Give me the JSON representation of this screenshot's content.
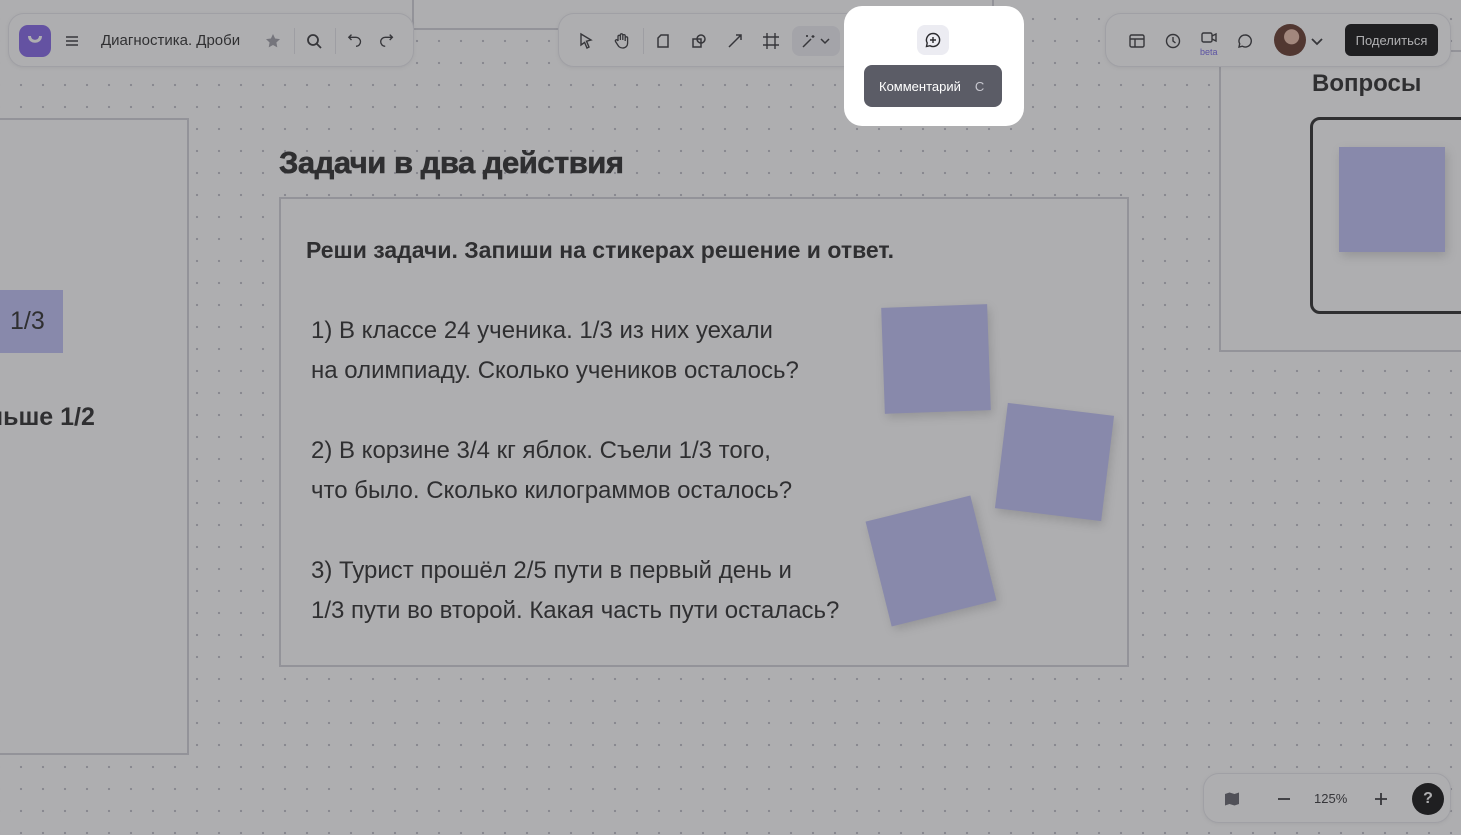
{
  "app": {
    "title": "Диагностика. Дроби",
    "accent": "#7b5ce6"
  },
  "toolbar_left": {
    "icons": [
      "logo-icon",
      "menu-icon",
      "star-icon",
      "search-icon",
      "undo-icon",
      "redo-icon"
    ]
  },
  "toolbar_center": {
    "tools": [
      "select-tool",
      "hand-tool",
      "sticker-tool",
      "shapes-tool",
      "line-tool",
      "frame-tool",
      "magic-tool",
      "text-tool",
      "attach-tool",
      "comment-tool"
    ]
  },
  "tooltip": {
    "label": "Комментарий",
    "shortcut": "C"
  },
  "toolbar_right": {
    "video_badge": "beta",
    "share_label": "Поделиться"
  },
  "board": {
    "left_sticker": "1/3",
    "left_text": "ньше 1/2",
    "right_heading": "Вопросы",
    "title": "Задачи в два действия",
    "instruction": "Реши задачи. Запиши на стикерах решение и ответ.",
    "tasks": [
      [
        "1) В классе 24 ученика. 1/3 из них уехали",
        "на олимпиаду. Сколько учеников осталось?"
      ],
      [
        "2) В корзине 3/4 кг яблок. Съели 1/3 того,",
        "что было. Сколько килограммов осталось?"
      ],
      [
        "3) Турист прошёл 2/5 пути в первый день и",
        "1/3 пути во второй. Какая часть пути осталась?"
      ]
    ],
    "sticker_color": "#bcbdf7"
  },
  "zoom": {
    "level": "125%",
    "help": "?"
  }
}
